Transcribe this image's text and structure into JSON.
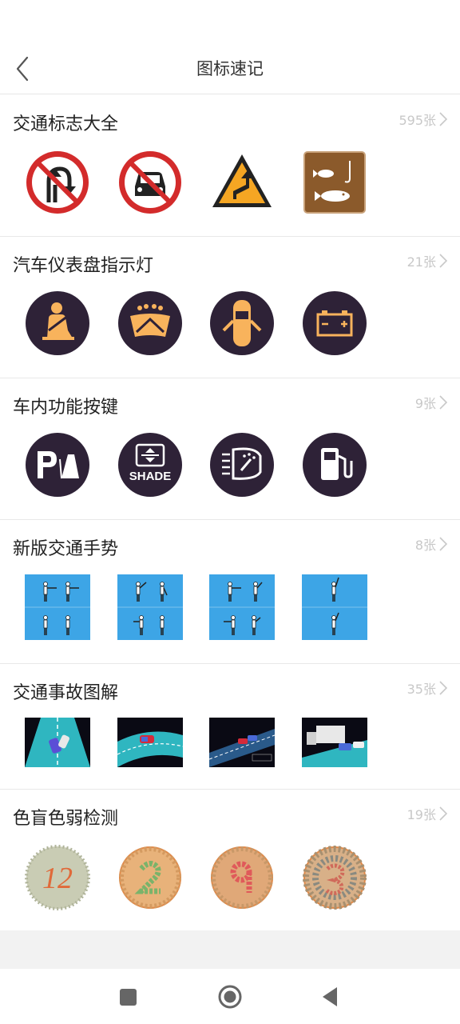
{
  "header": {
    "title": "图标速记"
  },
  "sections": [
    {
      "title": "交通标志大全",
      "count": "595张"
    },
    {
      "title": "汽车仪表盘指示灯",
      "count": "21张"
    },
    {
      "title": "车内功能按键",
      "count": "9张"
    },
    {
      "title": "新版交通手势",
      "count": "8张"
    },
    {
      "title": "交通事故图解",
      "count": "35张"
    },
    {
      "title": "色盲色弱检测",
      "count": "19张"
    }
  ],
  "button_icon_text": {
    "shade": "SHADE"
  },
  "colorblind": {
    "plate1": "12"
  },
  "colors": {
    "dashboard_bg": "#2e2237",
    "dashboard_fg": "#f8b35c",
    "gesture_bg": "#3da5e6",
    "accident_road": "#2fb6c0"
  }
}
